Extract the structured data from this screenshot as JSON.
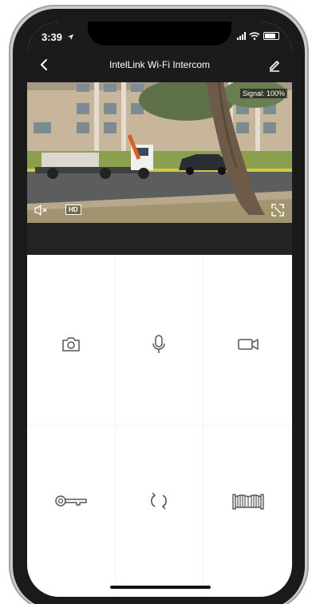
{
  "status_bar": {
    "time": "3:39",
    "location_icon": "location-arrow-icon",
    "icons": [
      "cellular-signal-icon",
      "wifi-icon",
      "battery-icon"
    ]
  },
  "nav": {
    "title": "IntelLink Wi-Fi Intercom",
    "back_icon": "chevron-left-icon",
    "edit_icon": "pencil-icon"
  },
  "video": {
    "signal_label": "Signal: 100%",
    "hd_label": "HD",
    "mute_icon": "speaker-mute-icon",
    "fullscreen_icon": "fullscreen-icon"
  },
  "controls": [
    {
      "name": "snapshot",
      "icon": "camera-icon"
    },
    {
      "name": "talk",
      "icon": "microphone-icon"
    },
    {
      "name": "record",
      "icon": "video-camera-icon"
    },
    {
      "name": "unlock",
      "icon": "key-icon"
    },
    {
      "name": "switch",
      "icon": "refresh-icon"
    },
    {
      "name": "gate",
      "icon": "gate-icon"
    }
  ],
  "colors": {
    "header_bg": "#1b1b1d",
    "video_bar": "#222324",
    "icon_stroke": "#555555"
  }
}
